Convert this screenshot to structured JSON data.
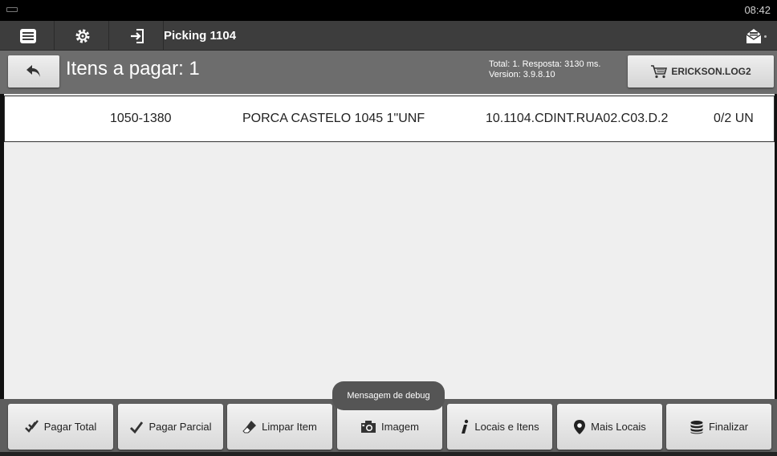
{
  "status_bar": {
    "time": "08:42"
  },
  "action_bar": {
    "title": "Picking 1104",
    "icons": [
      "menu-icon",
      "settings-icon",
      "login-icon",
      "mail-icon"
    ]
  },
  "header": {
    "title": "Itens a pagar: 1",
    "info_line1": "Total: 1. Resposta: 3130 ms.",
    "info_line2": "Version: 3.9.8.10",
    "user_label": "ERICKSON.LOG2"
  },
  "items": [
    {
      "code": "1050-1380",
      "description": "PORCA CASTELO 1045 1\"UNF",
      "location": "10.1104.CDINT.RUA02.C03.D.2",
      "quantity": "0/2 UN"
    }
  ],
  "toast": {
    "message": "Mensagem de debug"
  },
  "footer": {
    "buttons": [
      {
        "label": "Pagar Total",
        "icon": "double-check-icon"
      },
      {
        "label": "Pagar Parcial",
        "icon": "check-icon"
      },
      {
        "label": "Limpar Item",
        "icon": "eraser-icon"
      },
      {
        "label": "Imagem",
        "icon": "camera-icon"
      },
      {
        "label": "Locais e Itens",
        "icon": "info-icon"
      },
      {
        "label": "Mais Locais",
        "icon": "location-pin-icon"
      },
      {
        "label": "Finalizar",
        "icon": "database-icon"
      }
    ]
  },
  "colors": {
    "action_bar": "#3d3d3d",
    "header_bar": "#6d6d6d",
    "content_bg": "#efefef",
    "footer_bg": "#5e5e5e"
  }
}
